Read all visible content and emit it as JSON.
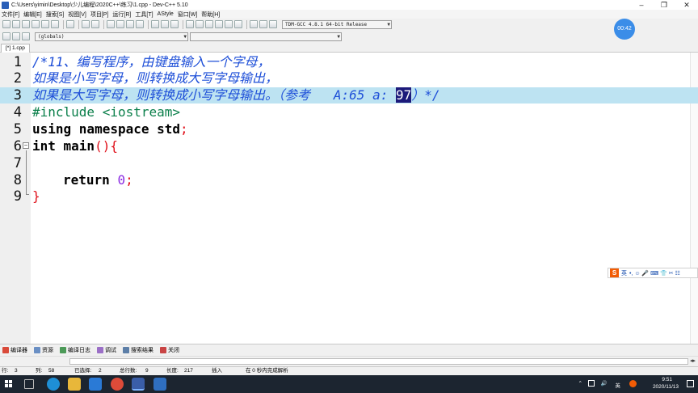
{
  "window": {
    "title": "C:\\Users\\yimin\\Desktop\\少儿编程\\2020C++\\练习\\1.cpp - Dev-C++ 5.10",
    "controls": [
      "–",
      "❐",
      "✕"
    ]
  },
  "menu": [
    "文件[F]",
    "编辑[E]",
    "搜索[S]",
    "视图[V]",
    "项目[P]",
    "运行[R]",
    "工具[T]",
    "AStyle",
    "窗口[W]",
    "帮助[H]"
  ],
  "toolbar": {
    "compiler_select": "TDM-GCC 4.8.1 64-bit Release",
    "scope_select": "(globals)"
  },
  "timer": "00:42",
  "file_tab": "[*] 1.cpp",
  "editor": {
    "line_numbers": [
      "1",
      "2",
      "3",
      "4",
      "5",
      "6",
      "7",
      "8",
      "9"
    ],
    "current_line": 3,
    "lines": [
      {
        "comment": "/*11、编写程序，由键盘输入一个字母，"
      },
      {
        "comment": "如果是小写字母，则转换成大写字母输出，"
      },
      {
        "comment_a": "如果是大写字母，则转换成小写字母输出。（参考   A:65 a: ",
        "selected": "97",
        "comment_b": "）*/"
      },
      {
        "text": "#include <iostream>"
      },
      {
        "kw": "using namespace std",
        "sym": ";"
      },
      {
        "kw": "int main",
        "sym": "(){"
      },
      {},
      {
        "kw": "return ",
        "num": "0",
        "sym": ";"
      },
      {
        "sym": "}"
      }
    ]
  },
  "ime": {
    "logo": "S",
    "lang": "英",
    "icons": "•, ☺ 🎤 ⌨ 👕 ✂ ☷"
  },
  "bottom_tabs": [
    "编译器",
    "资源",
    "编译日志",
    "调试",
    "搜索结果",
    "关闭"
  ],
  "status": {
    "row_label": "行:",
    "row": "3",
    "col_label": "列:",
    "col": "58",
    "selected_label": "已选择:",
    "selected": "2",
    "total_label": "总行数:",
    "total": "9",
    "length_label": "长度:",
    "length": "217",
    "mode": "插入",
    "parse": "在 0 秒内完成解析"
  },
  "tray": {
    "time": "9:51",
    "date": "2020/11/13",
    "lang": "英",
    "arrow": "⌃",
    "volume": "🔊"
  },
  "colors": {
    "current_line": "#bde3f2",
    "comment": "#1e4fd8",
    "preprocessor": "#0a7f4a",
    "symbol": "#e0101a",
    "number": "#8b2be2",
    "selection": "#1c1a7a"
  }
}
